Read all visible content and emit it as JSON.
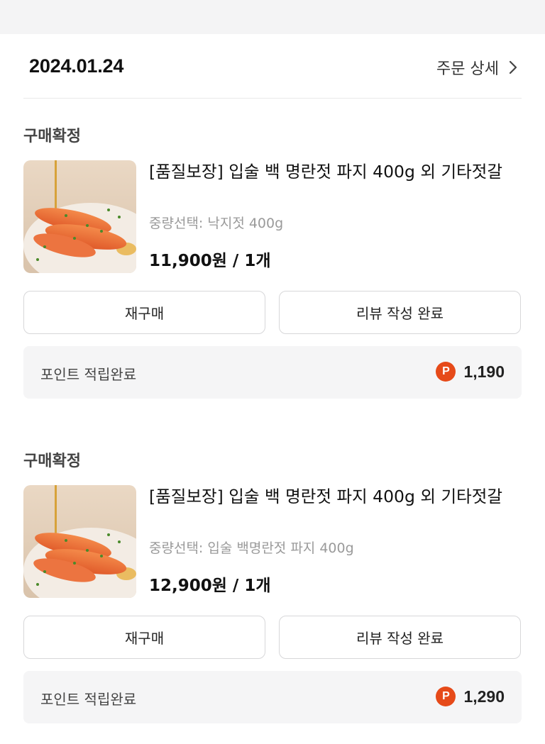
{
  "order": {
    "date": "2024.01.24",
    "detail_label": "주문 상세"
  },
  "items": [
    {
      "status": "구매확정",
      "title": "[품질보장] 입술 백 명란젓 파지 400g 외 기타젓갈",
      "option": "중량선택: 낙지젓 400g",
      "price": "11,900원 / 1개",
      "rebuy_label": "재구매",
      "review_label": "리뷰 작성 완료",
      "points_label": "포인트 적립완료",
      "points_badge": "P",
      "points_value": "1,190"
    },
    {
      "status": "구매확정",
      "title": "[품질보장] 입술 백 명란젓 파지 400g 외 기타젓갈",
      "option": "중량선택: 입술 백명란젓 파지 400g",
      "price": "12,900원 / 1개",
      "rebuy_label": "재구매",
      "review_label": "리뷰 작성 완료",
      "points_label": "포인트 적립완료",
      "points_badge": "P",
      "points_value": "1,290"
    }
  ],
  "icons": {
    "detail": "chevron-right-icon",
    "points": "point-badge-icon",
    "thumbnail": "product-thumbnail"
  },
  "colors": {
    "point_badge": "#e64a19",
    "option_text": "#9a9a9a",
    "points_bg": "#f5f5f6"
  }
}
